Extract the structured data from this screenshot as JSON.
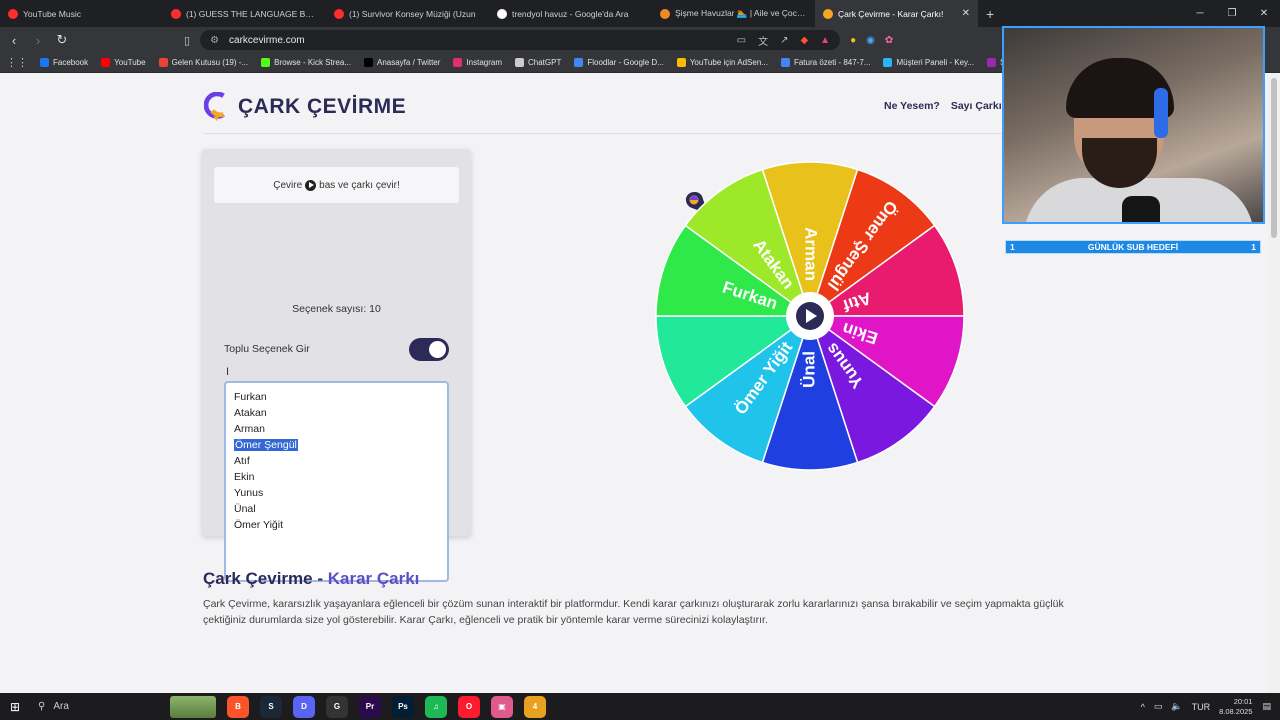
{
  "browser": {
    "tabs": [
      {
        "label": "YouTube Music",
        "color": "#ff2d2d"
      },
      {
        "label": "(1) GUESS THE LANGUAGE BY AUDIO",
        "color": "#ff2d2d"
      },
      {
        "label": "(1) Survivor Konsey Müziği (Uzun",
        "color": "#ff2d2d"
      },
      {
        "label": "trendyol havuz - Google'da Ara",
        "color": "#ffffff"
      },
      {
        "label": "Şişme Havuzlar 🏊 | Aile ve Çocukla",
        "color": "#f08a24"
      },
      {
        "label": "Çark Çevirme - Karar Çarkı!",
        "color": "#f5a623"
      }
    ],
    "active_tab_index": 5,
    "new_tab": "+",
    "url": "carkcevirme.com",
    "bookmarks": [
      {
        "label": "Facebook",
        "color": "#1877f2"
      },
      {
        "label": "YouTube",
        "color": "#ff0000"
      },
      {
        "label": "Gelen Kutusu (19) -...",
        "color": "#ea4335"
      },
      {
        "label": "Browse - Kick Strea...",
        "color": "#53fc18"
      },
      {
        "label": "Anasayfa / Twitter",
        "color": "#000000"
      },
      {
        "label": "Instagram",
        "color": "#e1306c"
      },
      {
        "label": "ChatGPT",
        "color": "#cccccc"
      },
      {
        "label": "Floodlar - Google D...",
        "color": "#4285f4"
      },
      {
        "label": "YouTube için AdSen...",
        "color": "#fbbc04"
      },
      {
        "label": "Fatura özeti - 847-7...",
        "color": "#4285f4"
      },
      {
        "label": "Müşteri Paneli - Key...",
        "color": "#29b6f6"
      },
      {
        "label": "Sh",
        "color": "#9c27b0"
      }
    ]
  },
  "site": {
    "logo_text": "ÇARK ÇEVİRME",
    "nav": [
      "Ne Yesem?",
      "Sayı Çarkı"
    ],
    "hint_before": "Çevire",
    "hint_after": "bas ve çarkı çevir!",
    "option_count_label": "Seçenek sayısı: 10",
    "bulk_toggle_label": "Toplu Seçenek Gir",
    "bulk_toggle_on": true,
    "options": [
      "Furkan",
      "Atakan",
      "Arman",
      "Ömer Şengül",
      "Atıf",
      "Ekin",
      "Yunus",
      "Ünal",
      "Ömer Yiğit"
    ],
    "selected_option_index": 3,
    "heading_main": "Çark Çevirme - ",
    "heading_accent": "Karar Çarkı",
    "description": "Çark Çevirme, kararsızlık yaşayanlara eğlenceli bir çözüm sunan interaktif bir platformdur. Kendi karar çarkınızı oluşturarak zorlu kararlarınızı şansa bırakabilir ve seçim yapmakta güçlük çektiğiniz durumlarda size yol gösterebilir. Karar Çarkı, eğlenceli ve pratik bir yöntemle karar verme sürecinizi kolaylaştırır."
  },
  "wheel": {
    "segments": [
      {
        "label": "Arman",
        "color": "#e8c21a"
      },
      {
        "label": "Ömer Şengül",
        "color": "#ec3a17"
      },
      {
        "label": "Atıf",
        "color": "#e81b6e"
      },
      {
        "label": "Ekin",
        "color": "#e015c8"
      },
      {
        "label": "Yunus",
        "color": "#7b18e0"
      },
      {
        "label": "Ünal",
        "color": "#1f3fe0"
      },
      {
        "label": "Ömer Yiğit",
        "color": "#20c4ea"
      },
      {
        "label": "",
        "color": "#22e89a"
      },
      {
        "label": "Furkan",
        "color": "#2fe84a"
      },
      {
        "label": "Atakan",
        "color": "#9ee82a"
      }
    ]
  },
  "overlay": {
    "goal_left": "1",
    "goal_label": "GÜNLÜK SUB HEDEFİ",
    "goal_right": "1"
  },
  "taskbar": {
    "search_placeholder": "Ara",
    "language": "TUR",
    "time": "20:01",
    "date": "8.08.2025",
    "apps": [
      {
        "name": "Brave",
        "color": "#fb542b",
        "glyph": "B"
      },
      {
        "name": "Steam",
        "color": "#1b2838",
        "glyph": "S"
      },
      {
        "name": "Discord",
        "color": "#5865f2",
        "glyph": "D"
      },
      {
        "name": "Chrome",
        "color": "#333333",
        "glyph": "G"
      },
      {
        "name": "Premiere",
        "color": "#2a0a4a",
        "glyph": "Pr"
      },
      {
        "name": "Photoshop",
        "color": "#001e36",
        "glyph": "Ps"
      },
      {
        "name": "Spotify",
        "color": "#1db954",
        "glyph": "♫"
      },
      {
        "name": "Opera",
        "color": "#ff1b2d",
        "glyph": "O"
      },
      {
        "name": "Gallery",
        "color": "#e05a8a",
        "glyph": "▣"
      },
      {
        "name": "App4",
        "color": "#e8a020",
        "glyph": "4"
      }
    ]
  }
}
